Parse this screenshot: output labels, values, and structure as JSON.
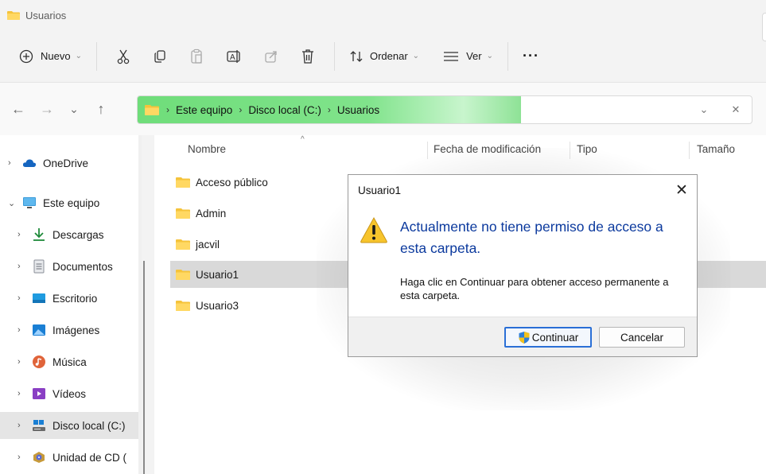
{
  "window": {
    "title": "Usuarios"
  },
  "toolbar": {
    "new_label": "Nuevo",
    "sort_label": "Ordenar",
    "view_label": "Ver",
    "more_label": "···",
    "icons": [
      "add-icon",
      "cut-icon",
      "copy-icon",
      "paste-icon",
      "rename-icon",
      "share-icon",
      "delete-icon",
      "sort-icon",
      "view-icon"
    ]
  },
  "address": {
    "crumbs": [
      "Este equipo",
      "Disco local (C:)",
      "Usuarios"
    ],
    "sep": "›",
    "chevron": "⌄",
    "clear": "✕"
  },
  "nav": {
    "back": "←",
    "forward": "→",
    "recent": "⌄",
    "up": "↑"
  },
  "sidebar": {
    "items": [
      {
        "label": "OneDrive",
        "expander": "›",
        "icon": "cloud-icon"
      },
      {
        "label": "Este equipo",
        "expander": "⌄",
        "icon": "computer-icon"
      },
      {
        "label": "Descargas",
        "expander": "›",
        "icon": "download-icon"
      },
      {
        "label": "Documentos",
        "expander": "›",
        "icon": "document-icon"
      },
      {
        "label": "Escritorio",
        "expander": "›",
        "icon": "desktop-icon"
      },
      {
        "label": "Imágenes",
        "expander": "›",
        "icon": "pictures-icon"
      },
      {
        "label": "Música",
        "expander": "›",
        "icon": "music-icon"
      },
      {
        "label": "Vídeos",
        "expander": "›",
        "icon": "videos-icon"
      },
      {
        "label": "Disco local (C:)",
        "expander": "›",
        "icon": "drive-icon",
        "selected": true
      },
      {
        "label": "Unidad de CD (",
        "expander": "›",
        "icon": "cd-drive-icon"
      }
    ]
  },
  "files": {
    "columns": [
      "Nombre",
      "Fecha de modificación",
      "Tipo",
      "Tamaño"
    ],
    "sort_indicator": "^",
    "rows": [
      {
        "name": "Acceso público"
      },
      {
        "name": "Admin"
      },
      {
        "name": "jacvil"
      },
      {
        "name": "Usuario1",
        "selected": true
      },
      {
        "name": "Usuario3"
      }
    ]
  },
  "dialog": {
    "title": "Usuario1",
    "close": "✕",
    "heading": "Actualmente no tiene permiso de acceso a esta carpeta.",
    "message": "Haga clic en Continuar para obtener acceso permanente a esta carpeta.",
    "continue_label": "Continuar",
    "cancel_label": "Cancelar",
    "icon": "warning-icon"
  },
  "colors": {
    "address_highlight": "#6fdd7a",
    "heading_blue": "#0c3a9e",
    "folder_yellow": "#f5c33b",
    "primary_border": "#2a6fd6"
  }
}
